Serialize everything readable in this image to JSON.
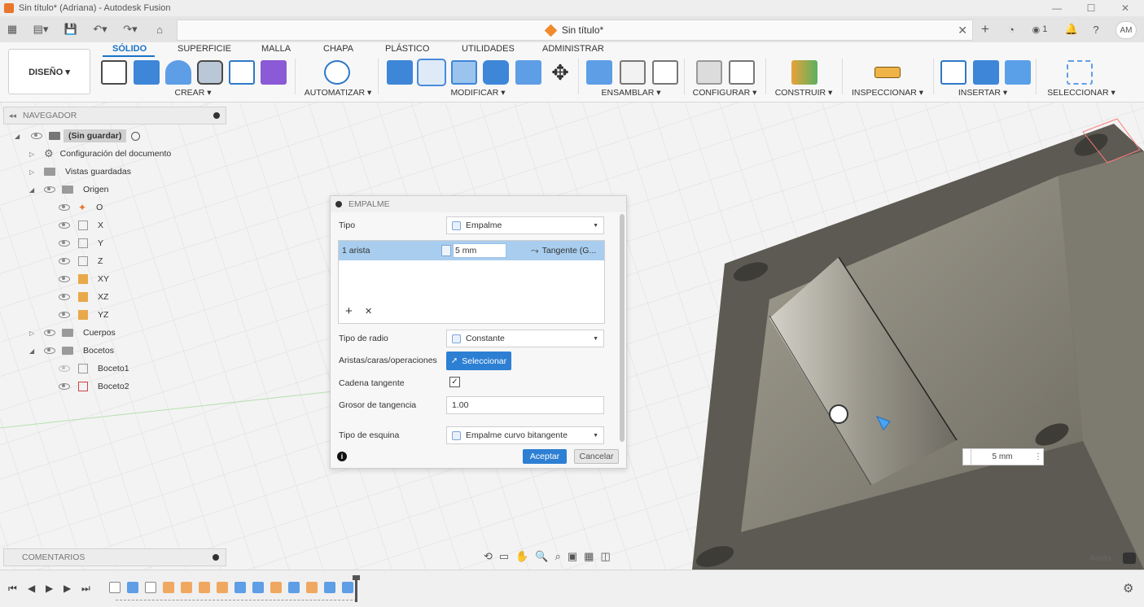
{
  "window": {
    "title": "Sin título* (Adriana) - Autodesk Fusion",
    "controls": {
      "minimize": "—",
      "maximize": "☐",
      "close": "✕"
    }
  },
  "quick_access": {
    "doc_tab_title": "Sin título*",
    "doc_tab_close": "✕",
    "right": {
      "plus": "+",
      "notification_count": "1",
      "user_initials": "AM"
    }
  },
  "ribbon": {
    "workspace_label": "DISEÑO ▾",
    "tabs": [
      "SÓLIDO",
      "SUPERFICIE",
      "MALLA",
      "CHAPA",
      "PLÁSTICO",
      "UTILIDADES",
      "ADMINISTRAR"
    ],
    "active_tab": "SÓLIDO",
    "groups": [
      "CREAR ▾",
      "AUTOMATIZAR ▾",
      "MODIFICAR ▾",
      "ENSAMBLAR ▾",
      "CONFIGURAR ▾",
      "CONSTRUIR ▾",
      "INSPECCIONAR ▾",
      "INSERTAR ▾",
      "SELECCIONAR ▾"
    ]
  },
  "browser": {
    "header": "NAVEGADOR",
    "root": "(Sin guardar)",
    "items": [
      {
        "label": "Configuración del documento"
      },
      {
        "label": "Vistas guardadas"
      },
      {
        "label": "Origen"
      },
      {
        "label": "O"
      },
      {
        "label": "X"
      },
      {
        "label": "Y"
      },
      {
        "label": "Z"
      },
      {
        "label": "XY"
      },
      {
        "label": "XZ"
      },
      {
        "label": "YZ"
      },
      {
        "label": "Cuerpos"
      },
      {
        "label": "Bocetos"
      },
      {
        "label": "Boceto1"
      },
      {
        "label": "Boceto2"
      }
    ]
  },
  "comments": {
    "label": "COMENTARIOS"
  },
  "dialog": {
    "title": "EMPALME",
    "tipo_label": "Tipo",
    "tipo_value": "Empalme",
    "selection_row": {
      "count": "1 arista",
      "radius": "5 mm",
      "continuity": "Tangente (G..."
    },
    "add_icon": "+",
    "remove_icon": "✕",
    "radius_type_label": "Tipo de radio",
    "radius_type_value": "Constante",
    "edges_label": "Aristas/caras/operaciones",
    "edges_button": "Seleccionar",
    "chain_label": "Cadena tangente",
    "chain_checked": true,
    "tangency_label": "Grosor de tangencia",
    "tangency_value": "1.00",
    "corner_label": "Tipo de esquina",
    "corner_value": "Empalme curvo bitangente",
    "accept": "Aceptar",
    "cancel": "Cancelar",
    "info_icon": "i"
  },
  "viewport": {
    "dimension_value": "5 mm",
    "status_label": "Arista"
  },
  "colors": {
    "accent": "#1a73c7",
    "selection_row": "#a9cdee",
    "model_dark": "#5c5a52",
    "model_face": "#8c897d",
    "accept_button": "#2d7fd3"
  }
}
